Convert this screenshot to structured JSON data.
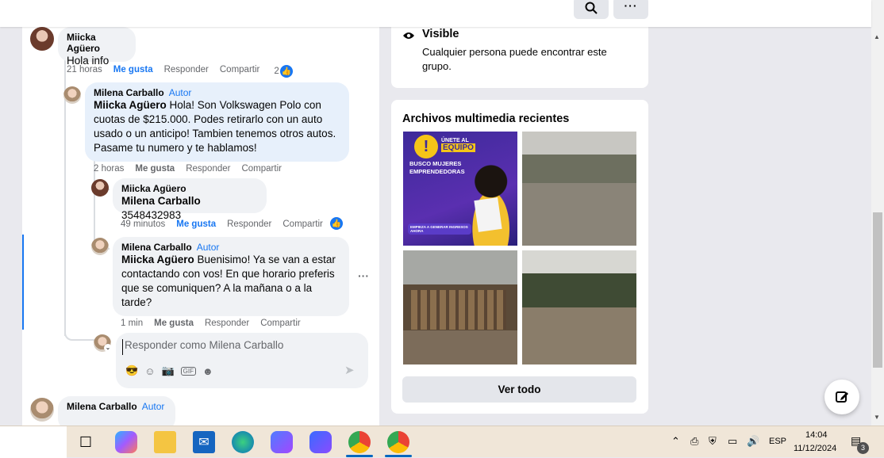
{
  "comments": [
    {
      "name": "Miicka Agüero",
      "text": "Hola info",
      "time": "21 horas",
      "like": "Me gusta",
      "reply": "Responder",
      "share": "Compartir",
      "reactions": "2"
    },
    {
      "name": "Milena Carballo",
      "author": "Autor",
      "mention": "Miicka Agüero",
      "text": " Hola! Son Volkswagen Polo con cuotas de $215.000. Podes retirarlo con un auto usado o un anticipo! Tambien tenemos otros autos. Pasame tu numero y te hablamos!",
      "time": "2 horas",
      "like": "Me gusta",
      "reply": "Responder",
      "share": "Compartir"
    },
    {
      "name": "Miicka Agüero",
      "mention": "Milena Carballo",
      "text": " 3548432983",
      "time": "49 minutos",
      "like": "Me gusta",
      "reply": "Responder",
      "share": "Compartir"
    },
    {
      "name": "Milena Carballo",
      "author": "Autor",
      "mention": "Miicka Agüero",
      "text": " Buenisimo! Ya se van a estar contactando con vos! En que horario preferis que se comuniquen? A la mañana o a la tarde?",
      "time": "1 min",
      "like": "Me gusta",
      "reply": "Responder",
      "share": "Compartir",
      "more": "···"
    },
    {
      "name": "Milena Carballo",
      "author": "Autor"
    }
  ],
  "reply_box": {
    "placeholder": "Responder como Milena Carballo"
  },
  "group_info": {
    "title": "Visible",
    "description": "Cualquier persona puede encontrar este grupo."
  },
  "media": {
    "title": "Archivos multimedia recientes",
    "see_all": "Ver todo",
    "promo": {
      "line1": "ÚNETE AL",
      "line2": "EQUIPO",
      "line3": "BUSCO MUJERES",
      "line4": "EMPRENDEDORAS",
      "cta": "EMPIEZA A GENERAR INGRESOS AHORA"
    }
  },
  "taskbar": {
    "lang": "ESP",
    "time": "14:04",
    "date": "11/12/2024",
    "notifications": "3"
  },
  "colors": {
    "facebook_blue": "#1877f2",
    "author_bubble": "#e7f0fb",
    "bubble": "#f0f2f5"
  }
}
